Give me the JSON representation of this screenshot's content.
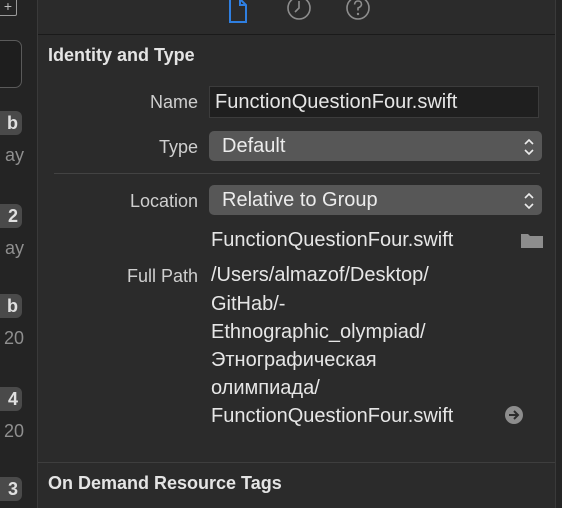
{
  "left_strip": {
    "add_symbol": "+",
    "badges": [
      "b",
      "2",
      "b",
      "4",
      "3"
    ],
    "texts": [
      "ay",
      "ay",
      "20",
      "20"
    ]
  },
  "inspector": {
    "tabs": [
      "file-inspector",
      "history-inspector",
      "quick-help-inspector"
    ],
    "identity_section": {
      "title": "Identity and Type",
      "name_label": "Name",
      "name_value": "FunctionQuestionFour.swift",
      "type_label": "Type",
      "type_value": "Default",
      "location_label": "Location",
      "location_value": "Relative to Group",
      "file_name": "FunctionQuestionFour.swift",
      "full_path_label": "Full Path",
      "full_path_lines": [
        "/Users/almazof/Desktop/",
        "GitHab/-",
        "Ethnographic_olympiad/",
        "Этнографическая",
        "олимпиада/",
        "FunctionQuestionFour.swift"
      ]
    },
    "on_demand_section": {
      "title": "On Demand Resource Tags"
    }
  },
  "colors": {
    "panel_bg": "#2b2b2b",
    "popup_bg": "#575757",
    "accent_selected_tab": "#2f7fe0"
  }
}
